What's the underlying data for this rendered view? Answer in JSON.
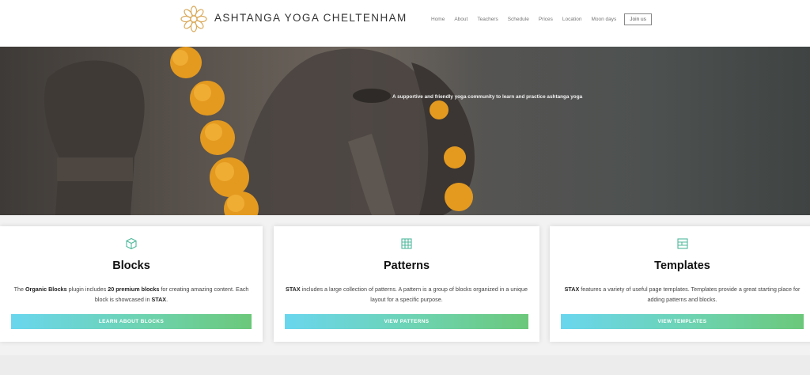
{
  "site": {
    "title": "ASHTANGA YOGA CHELTENHAM",
    "logo_icon": "mandala-logo-icon"
  },
  "nav": {
    "items": [
      "Home",
      "About",
      "Teachers",
      "Schedule",
      "Prices",
      "Location",
      "Moon days"
    ],
    "cta": "Join us"
  },
  "hero": {
    "tagline": "A supportive and friendly yoga community to learn and practice ashtanga yoga"
  },
  "cards": [
    {
      "icon": "cube-icon",
      "title": "Blocks",
      "desc_parts": [
        "The ",
        "Organic Blocks",
        " plugin includes ",
        "20 premium blocks",
        " for creating amazing content. Each block is showcased in ",
        "STAX",
        "."
      ],
      "button": "LEARN ABOUT BLOCKS"
    },
    {
      "icon": "grid-icon",
      "title": "Patterns",
      "desc_parts": [
        "STAX",
        " includes a large collection of patterns. A pattern is a group of blocks organized in a unique layout for a specific purpose."
      ],
      "button": "VIEW PATTERNS"
    },
    {
      "icon": "layout-icon",
      "title": "Templates",
      "desc_parts": [
        "STAX",
        " features a variety of useful page templates. Templates provide a great starting place for adding patterns and blocks."
      ],
      "button": "VIEW TEMPLATES"
    }
  ],
  "colors": {
    "accent_teal": "#4fb89a",
    "button_gradient_start": "#6ad6ee",
    "button_gradient_end": "#6bc87a",
    "logo_gold": "#d9a95a"
  }
}
